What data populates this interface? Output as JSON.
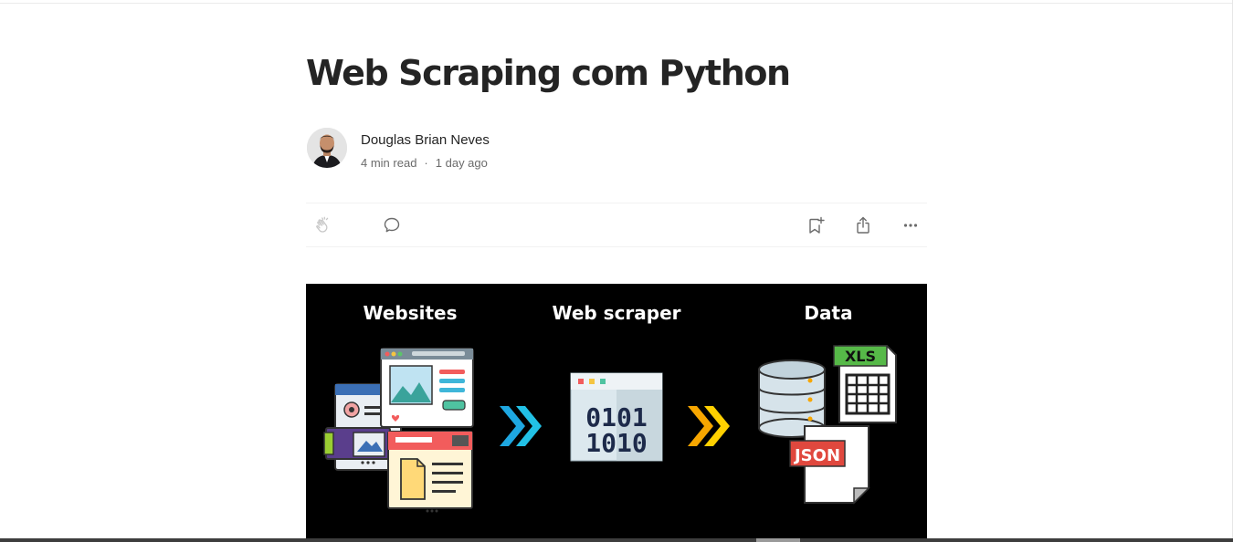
{
  "article": {
    "title": "Web Scraping com Python",
    "author": "Douglas Brian Neves",
    "read_time": "4 min read",
    "separator": "·",
    "published": "1 day ago"
  },
  "actions": {
    "clap_icon": "clap-icon",
    "comment_icon": "comment-icon",
    "save_icon": "bookmark-add-icon",
    "share_icon": "share-icon",
    "more_icon": "more-icon"
  },
  "hero_image": {
    "labels": [
      "Websites",
      "Web scraper",
      "Data"
    ],
    "binary_line_1": "0101",
    "binary_line_2": "1010",
    "badge_xls": "XLS",
    "badge_json": "JSON",
    "colors": {
      "background": "#000000",
      "arrow_blue": "#1ea7e1",
      "arrow_orange": "#f7b500"
    }
  }
}
